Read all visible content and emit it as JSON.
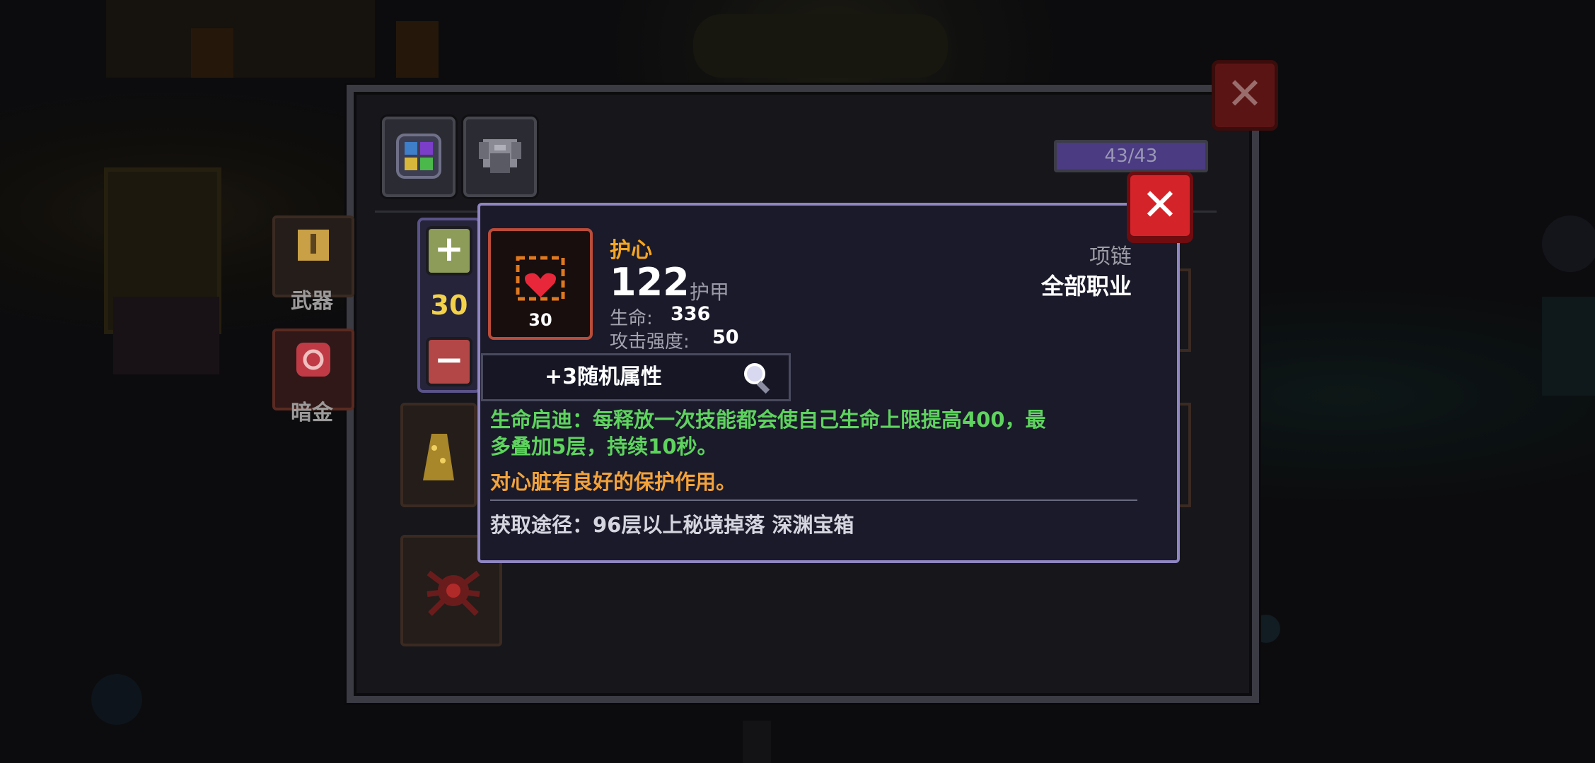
{
  "top_bar": {
    "capacity": "43/43",
    "capacity_fill_fraction": 1.0
  },
  "tabs": [
    {
      "icon": "potion-grid-icon"
    },
    {
      "icon": "armor-icon"
    }
  ],
  "side_slots": [
    {
      "label": "武器"
    },
    {
      "label": "暗金"
    }
  ],
  "counter": {
    "value": "30",
    "plus": "+",
    "minus": "−"
  },
  "tooltip": {
    "name": "护心",
    "armor_value": "122",
    "armor_label": "护甲",
    "stats": [
      {
        "label": "生命:",
        "value": "336"
      },
      {
        "label": "攻击强度:",
        "value": "50"
      }
    ],
    "item_level": "30",
    "slot_type": "项链",
    "classes": "全部职业",
    "random_attributes": "+3随机属性",
    "effect_line1": "生命启迪：每释放一次技能都会使自己生命上限提高400，最",
    "effect_line2": "多叠加5层，持续10秒。",
    "flavor": "对心脏有良好的保护作用。",
    "source": "获取途径：96层以上秘境掉落 深渊宝箱"
  },
  "colors": {
    "rarity": "#f5a623",
    "effect": "#5ed35e",
    "flavor": "#f3a23a",
    "close": "#d4242a"
  }
}
